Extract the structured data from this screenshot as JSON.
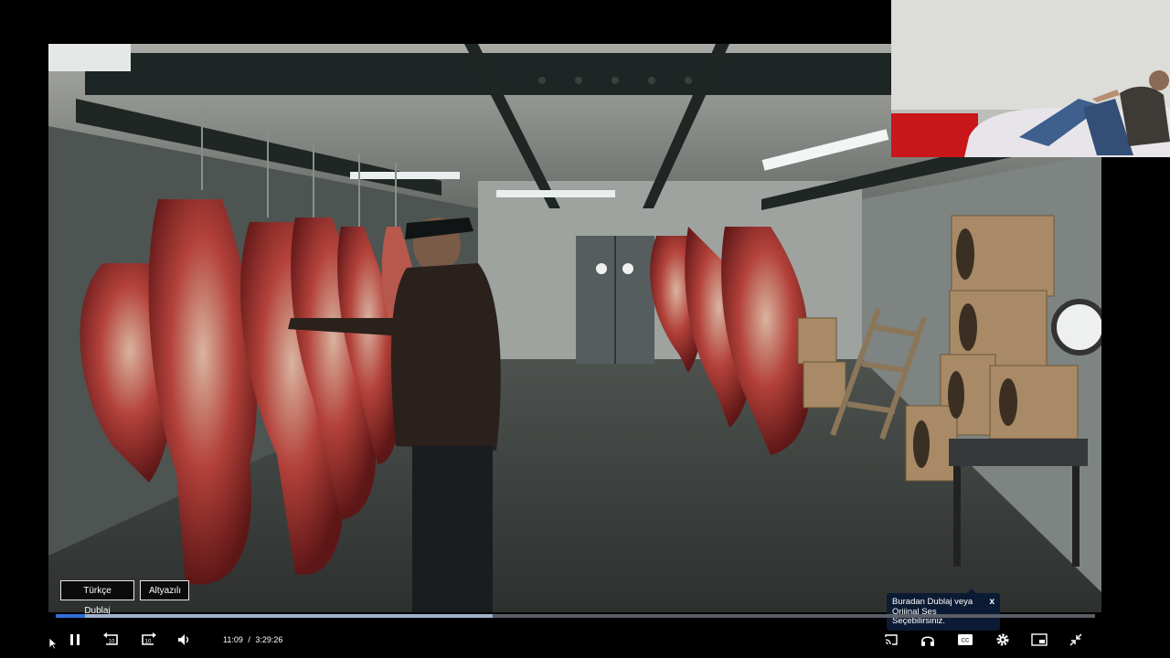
{
  "player": {
    "current_time": "11:09",
    "separator": "/",
    "duration": "3:29:26",
    "progress_fraction": 0.42,
    "state": "playing"
  },
  "audio_options": {
    "dub_label": "Türkçe Dublaj",
    "subtitle_label": "Altyazılı"
  },
  "tooltip": {
    "text": "Buradan Dublaj veya Orijinal Ses Seçebilirsiniz.",
    "close_label": "x"
  },
  "controls": {
    "left": [
      "pause-icon",
      "rewind-10-icon",
      "forward-10-icon",
      "volume-icon"
    ],
    "right": [
      "cast-icon",
      "headphones-icon",
      "captions-icon",
      "settings-gear-icon",
      "picture-in-picture-icon",
      "exit-fullscreen-icon"
    ],
    "captions_label": "CC",
    "skip_label": "10"
  },
  "colors": {
    "progress_played": "#9fb1cc",
    "progress_buffer": "#5a5f66",
    "progress_accent": "#2f6fd6",
    "tooltip_bg": "#0b1b33"
  }
}
